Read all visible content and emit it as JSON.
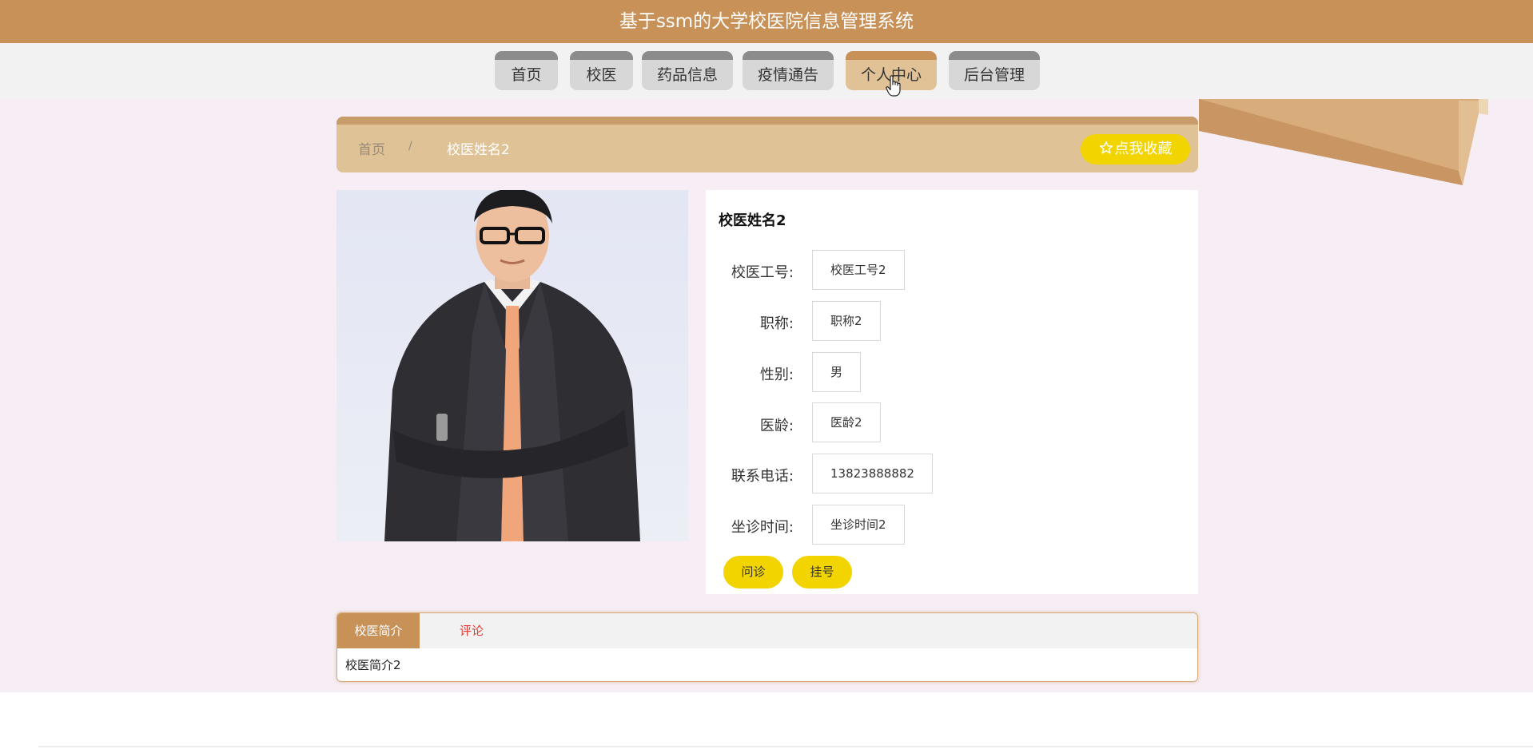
{
  "header": {
    "title": "基于ssm的大学校医院信息管理系统"
  },
  "nav": {
    "items": [
      {
        "label": "首页"
      },
      {
        "label": "校医"
      },
      {
        "label": "药品信息"
      },
      {
        "label": "疫情通告"
      },
      {
        "label": "个人中心"
      },
      {
        "label": "后台管理"
      }
    ],
    "active_index": 4
  },
  "breadcrumb": {
    "home": "首页",
    "separator": "/",
    "current": "校医姓名2"
  },
  "favorite": {
    "label": "点我收藏",
    "icon": "star-outline-icon"
  },
  "doctor": {
    "name": "校医姓名2",
    "fields": [
      {
        "label": "校医工号:",
        "value": "校医工号2"
      },
      {
        "label": "职称:",
        "value": "职称2"
      },
      {
        "label": "性别:",
        "value": "男"
      },
      {
        "label": "医龄:",
        "value": "医龄2"
      },
      {
        "label": "联系电话:",
        "value": "13823888882"
      },
      {
        "label": "坐诊时间:",
        "value": "坐诊时间2"
      }
    ]
  },
  "actions": {
    "consult": "问诊",
    "register": "挂号"
  },
  "tabs": {
    "items": [
      {
        "label": "校医简介"
      },
      {
        "label": "评论"
      }
    ],
    "content": "校医简介2"
  },
  "colors": {
    "brand": "#c89158",
    "breadcrumb_bg": "#dfc397",
    "button_yellow": "#f2d401",
    "page_bg": "#f6eef4",
    "tab_inactive_text": "#e53935"
  }
}
